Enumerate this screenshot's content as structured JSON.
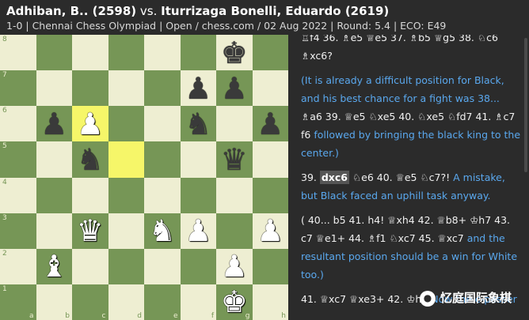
{
  "header": {
    "white_player": "Adhiban, B.. (2598)",
    "vs": " vs. ",
    "black_player": "Iturrizaga Bonelli, Eduardo (2619)",
    "meta": "1-0 | Chennai Chess Olympiad | Open / chess.com / 02 Aug 2022 | Round: 5.4 | ECO: E49"
  },
  "board": {
    "light_color": "#eeeed2",
    "dark_color": "#769656",
    "highlight_color": "#f6f669",
    "highlighted_squares": [
      "c6",
      "d5"
    ],
    "rank_labels": [
      "8",
      "7",
      "6",
      "5",
      "4",
      "3",
      "2",
      "1"
    ],
    "file_labels": [
      "a",
      "b",
      "c",
      "d",
      "e",
      "f",
      "g",
      "h"
    ],
    "pieces": {
      "g8": "bK",
      "f7": "bP",
      "g7": "bP",
      "b6": "bP",
      "c6": "wP",
      "f6": "bN",
      "h6": "bP",
      "c5": "bN",
      "g5": "bQ",
      "c3": "wQ",
      "e3": "wN",
      "f3": "wP",
      "h3": "wP",
      "b2": "wB",
      "g2": "wP",
      "g1": "wK"
    }
  },
  "notation": {
    "top_line": "♖f4 36. ♗e5 ♕e5 37. ♗b5 ♕g5 38. ♘c6",
    "p0_move": "♗xc6?",
    "p1_comment_a": "(It is already a difficult position for Black, and his best chance for a fight was 38... ",
    "p1_m1": "♗a6",
    "p1_t1": " 39. ",
    "p1_m2": "♕e5 ♘xe5 40. ♘xe5 ♘fd7 41. ♗c7",
    "p1_m3": "f6",
    "p1_comment_b": " followed by bringing the black king to the center.)",
    "p2_num": "39. ",
    "p2_cur": "dxc6",
    "p2_moves": " ♘e6 40. ♕e5 ♘c7?!",
    "p2_comment": " A mistake, but Black faced an uphill task anyway.",
    "p3_a": "( 40... ",
    "p3_m1": "b5",
    "p3_t1": " 41. ",
    "p3_m2": "h4! ♕xh4 42. ♕b8+ ♔h7 43. c7 ♕e1+ 44. ♗f1 ♘xc7 45. ♕xc7",
    "p3_comment": " and the resultant position should be a win for White too.)",
    "p4_moves": "41. ♕xc7 ♕xe3+ 42. ♔h2",
    "p4_comment": " Now the c-passer"
  },
  "watermark": {
    "icon": "wechat-icon",
    "text": "忆庭国际象棋"
  }
}
